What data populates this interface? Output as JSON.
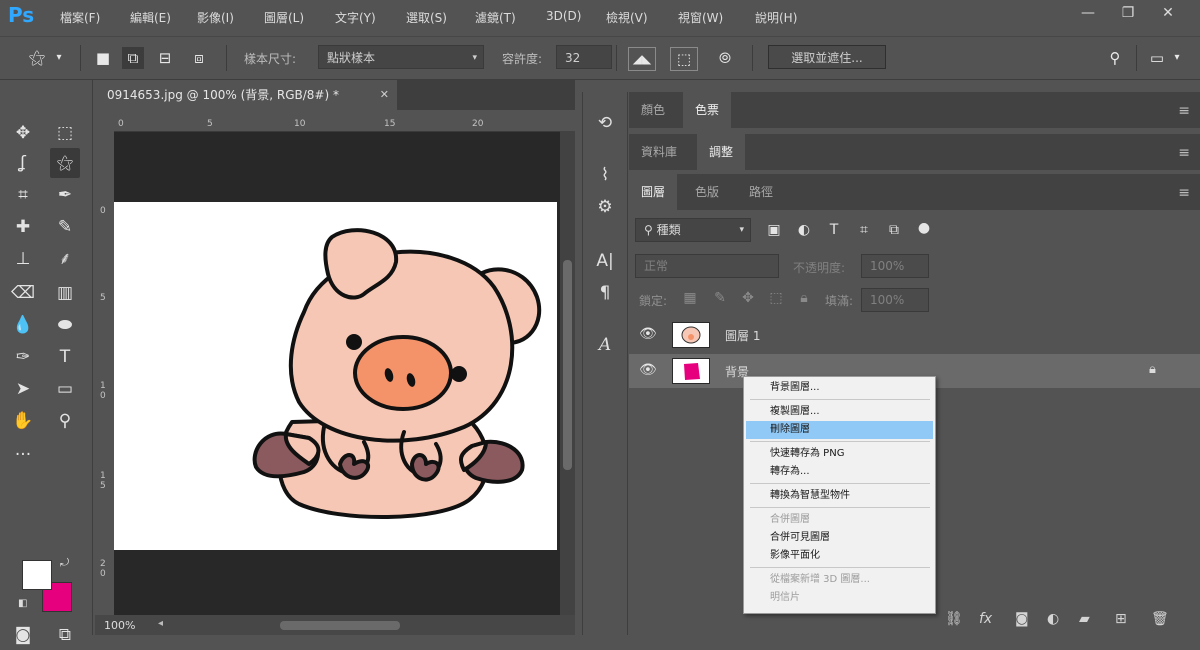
{
  "app": {
    "logo": "Ps"
  },
  "menu": [
    "檔案(F)",
    "編輯(E)",
    "影像(I)",
    "圖層(L)",
    "文字(Y)",
    "選取(S)",
    "濾鏡(T)",
    "3D(D)",
    "檢視(V)",
    "視窗(W)",
    "說明(H)"
  ],
  "window_controls": [
    "—",
    "❐",
    "✕"
  ],
  "options": {
    "sample_size_label": "樣本尺寸:",
    "sample_size_value": "點狀樣本",
    "tolerance_label": "容許度:",
    "tolerance_value": "32",
    "select_mask_button": "選取並遮住..."
  },
  "document": {
    "tab_title": "0914653.jpg @ 100% (背景, RGB/8#) *",
    "tab_close": "✕",
    "zoom": "100%",
    "ruler_top": [
      "0",
      "5",
      "10",
      "15",
      "20"
    ],
    "ruler_left": [
      "0",
      "5",
      "1\n0",
      "1\n5",
      "2\n0"
    ]
  },
  "panels": {
    "row1_tabs": [
      "顏色",
      "色票"
    ],
    "row2_tabs": [
      "資料庫",
      "調整"
    ],
    "row3_tabs": [
      "圖層",
      "色版",
      "路徑"
    ],
    "filter_kind": "種類",
    "blend_mode": "正常",
    "opacity_label": "不透明度:",
    "opacity_value": "100%",
    "lock_label": "鎖定:",
    "fill_label": "填滿:",
    "fill_value": "100%",
    "layers": [
      {
        "name": "圖層 1"
      },
      {
        "name": "背景"
      }
    ]
  },
  "context_menu": {
    "items": [
      {
        "label": "背景圖層...",
        "state": "normal"
      },
      {
        "label": "複製圖層...",
        "state": "normal"
      },
      {
        "label": "刪除圖層",
        "state": "highlighted"
      },
      {
        "label": "快速轉存為 PNG",
        "state": "normal"
      },
      {
        "label": "轉存為...",
        "state": "normal"
      },
      {
        "label": "轉換為智慧型物件",
        "state": "normal"
      },
      {
        "label": "合併圖層",
        "state": "disabled"
      },
      {
        "label": "合併可見圖層",
        "state": "normal"
      },
      {
        "label": "影像平面化",
        "state": "normal"
      },
      {
        "label": "從檔案新增 3D 圖層...",
        "state": "disabled"
      },
      {
        "label": "明信片",
        "state": "disabled"
      }
    ]
  },
  "colors": {
    "foreground": "#ffffff",
    "background": "#e6007e",
    "pig_body": "#f7c7b5",
    "pig_snout": "#f4936a",
    "pig_feet": "#8a5a5e"
  }
}
